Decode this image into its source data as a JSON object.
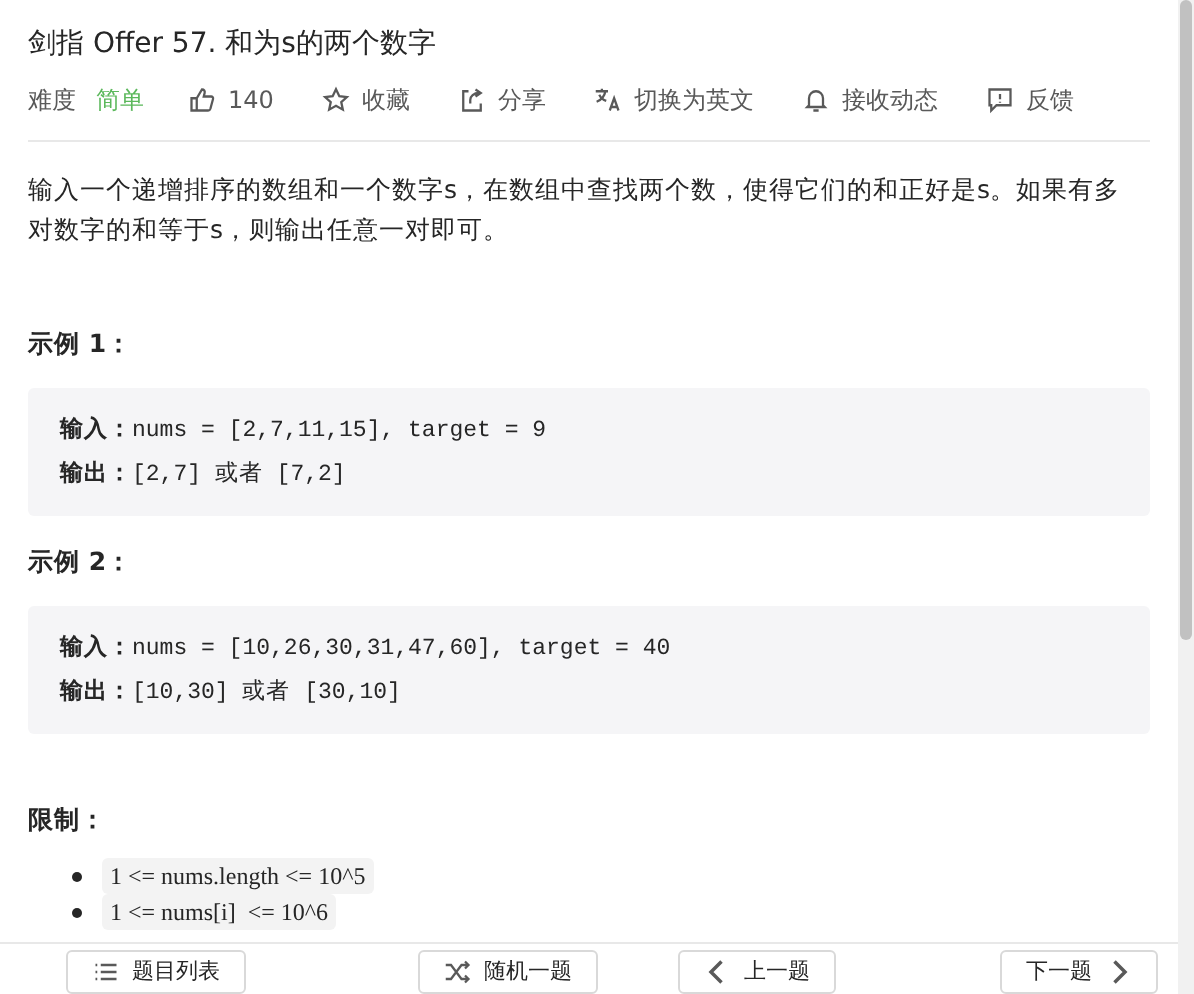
{
  "title": "剑指 Offer 57. 和为s的两个数字",
  "meta": {
    "difficulty_label": "难度",
    "difficulty": "简单",
    "actions": [
      {
        "kind": "like",
        "label": "140"
      },
      {
        "kind": "star",
        "label": "收藏"
      },
      {
        "kind": "share",
        "label": "分享"
      },
      {
        "kind": "translate",
        "label": "切换为英文"
      },
      {
        "kind": "bell",
        "label": "接收动态"
      },
      {
        "kind": "feedback",
        "label": "反馈"
      }
    ]
  },
  "description": "输入一个递增排序的数组和一个数字s，在数组中查找两个数，使得它们的和正好是s。如果有多对数字的和等于s，则输出任意一对即可。",
  "examples": [
    {
      "title": "示例 1：",
      "lines": [
        "**输入：**nums = [2,7,11,15], target = 9",
        "**输出：**[2,7] 或者 [7,2]"
      ]
    },
    {
      "title": "示例 2：",
      "lines": [
        "**输入：**nums = [10,26,30,31,47,60], target = 40",
        "**输出：**[10,30] 或者 [30,10]"
      ]
    }
  ],
  "constraints": {
    "title": "限制：",
    "items": [
      "1 <= nums.length <= 10^5",
      "1 <= nums[i]  <= 10^6"
    ]
  },
  "footer": [
    {
      "kind": "list",
      "label": "题目列表"
    },
    {
      "kind": "random",
      "label": "随机一题"
    },
    {
      "kind": "prev",
      "label": "上一题"
    },
    {
      "kind": "next",
      "label": "下一题"
    }
  ]
}
